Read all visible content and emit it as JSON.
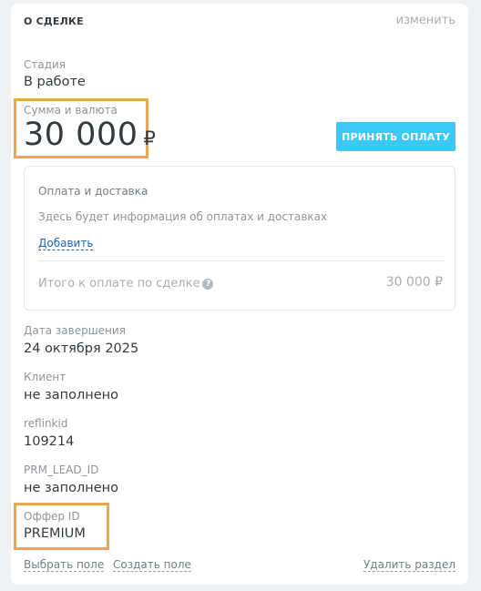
{
  "section": {
    "title": "О СДЕЛКЕ",
    "edit_label": "изменить"
  },
  "fields": {
    "stage": {
      "label": "Стадия",
      "value": "В работе"
    },
    "amount": {
      "label": "Сумма и валюта",
      "value": "30 000",
      "currency": "₽"
    },
    "accept_payment_label": "ПРИНЯТЬ ОПЛАТУ",
    "payment": {
      "title": "Оплата и доставка",
      "info": "Здесь будет информация об оплатах и доставках",
      "add_label": "Добавить",
      "total_label": "Итого к оплате по сделке",
      "total_value": "30 000 ₽"
    },
    "close_date": {
      "label": "Дата завершения",
      "value": "24 октября 2025"
    },
    "client": {
      "label": "Клиент",
      "value": "не заполнено"
    },
    "reflinkid": {
      "label": "reflinkid",
      "value": "109214"
    },
    "prm_lead_id": {
      "label": "PRM_LEAD_ID",
      "value": "не заполнено"
    },
    "offer_id": {
      "label": "Оффер ID",
      "value": "PREMIUM"
    }
  },
  "footer": {
    "choose_field": "Выбрать поле",
    "create_field": "Создать поле",
    "delete_section": "Удалить раздел"
  },
  "colors": {
    "accent_button": "#3bc8f5",
    "highlight_border": "#e8a84c",
    "link": "#2067b0"
  }
}
